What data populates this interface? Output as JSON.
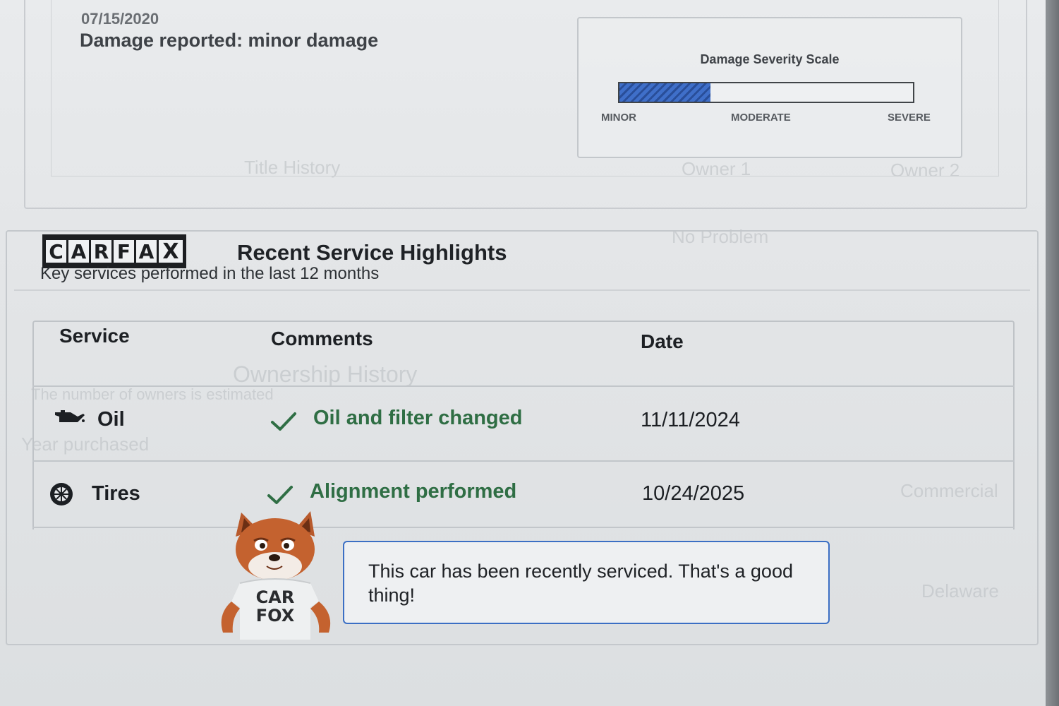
{
  "background_bleed": {
    "lines": [
      "Title History",
      "Owner 1",
      "Owner 2",
      "No Problem",
      "Ownership History",
      "The number of owners is estimated",
      "Year purchased",
      "Commercial",
      "Delaware"
    ]
  },
  "damage": {
    "date": "07/15/2020",
    "reported": "Damage reported: minor damage",
    "scale": {
      "title": "Damage Severity Scale",
      "level": 0.31,
      "labels": [
        "MINOR",
        "MODERATE",
        "SEVERE"
      ]
    }
  },
  "service_section": {
    "logo_letters": [
      "C",
      "A",
      "R",
      "F",
      "A",
      "X"
    ],
    "title": "Recent Service Highlights",
    "subtitle": "Key services performed in the last 12 months",
    "columns": [
      "Service",
      "Comments",
      "Date"
    ],
    "rows": [
      {
        "icon": "oil-can-icon",
        "service": "Oil",
        "comment": "Oil and filter changed",
        "date": "11/11/2024"
      },
      {
        "icon": "tire-icon",
        "service": "Tires",
        "comment": "Alignment performed",
        "date": "10/24/2025"
      }
    ],
    "callout": "This car has been recently serviced. That's a good thing!",
    "mascot_shirt": [
      "CAR",
      "FOX"
    ]
  },
  "colors": {
    "comment_green": "#2f6e44",
    "callout_blue": "#3b6fc4",
    "scale_fill_blue": "#3f6fc9"
  }
}
